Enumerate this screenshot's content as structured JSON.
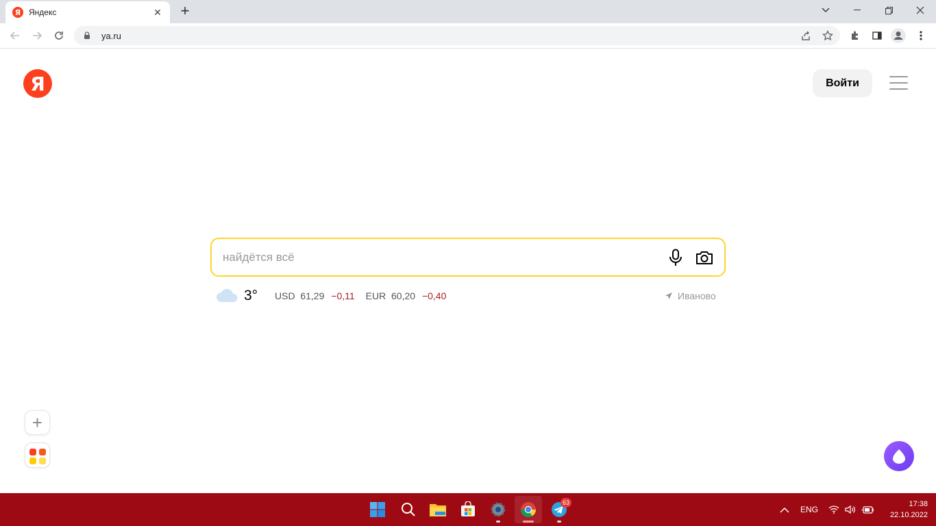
{
  "browser": {
    "tab_title": "Яндекс",
    "tab_favicon_letter": "Я",
    "url": "ya.ru"
  },
  "header": {
    "logo_letter": "Я",
    "login_label": "Войти"
  },
  "search": {
    "placeholder": "найдётся всё"
  },
  "info_bar": {
    "weather": {
      "temperature": "3°",
      "icon": "cloud-icon"
    },
    "rates": [
      {
        "currency": "USD",
        "value": "61,29",
        "change": "−0,11"
      },
      {
        "currency": "EUR",
        "value": "60,20",
        "change": "−0,40"
      }
    ],
    "location": "Иваново"
  },
  "taskbar": {
    "telegram_badge": "63",
    "language": "ENG",
    "time": "17:38",
    "date": "22.10.2022"
  },
  "colors": {
    "brand": "#fc3f1d",
    "search_border": "#fed42b",
    "taskbar": "#9e0a13",
    "alice": "#7a45f5"
  }
}
